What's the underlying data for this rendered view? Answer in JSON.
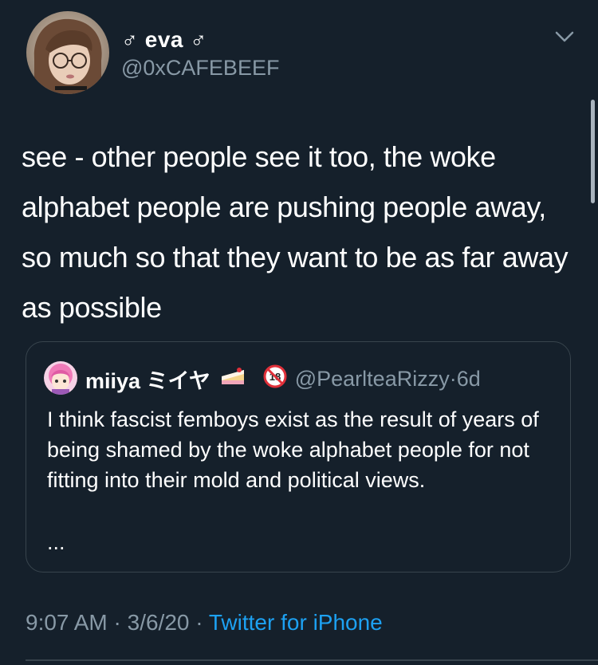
{
  "tweet": {
    "display_name": "♂ eva ♂",
    "handle": "@0xCAFEBEEF",
    "text": "see - other people see it too, the woke alphabet people are pushing people away, so much so that they want to be as far away as possible",
    "time": "9:07 AM",
    "date": "3/6/20",
    "source": "Twitter for iPhone",
    "separator": " · "
  },
  "quote": {
    "display_name": "miiya ミイヤ",
    "handle": "@PearlteaRizzy",
    "age": "6d",
    "dot": " · ",
    "text": "I think fascist femboys exist as the result of years of being shamed by the woke alphabet people for not fitting into their mold and political views.",
    "ellipsis": "...",
    "name_icons": [
      "cake-icon",
      "no-under-18-icon"
    ]
  },
  "icons": {
    "menu": "chevron-down-icon"
  },
  "colors": {
    "background": "#15202b",
    "text": "#ffffff",
    "secondary": "#8899a6",
    "link": "#1da1f2",
    "border": "#38444d"
  }
}
